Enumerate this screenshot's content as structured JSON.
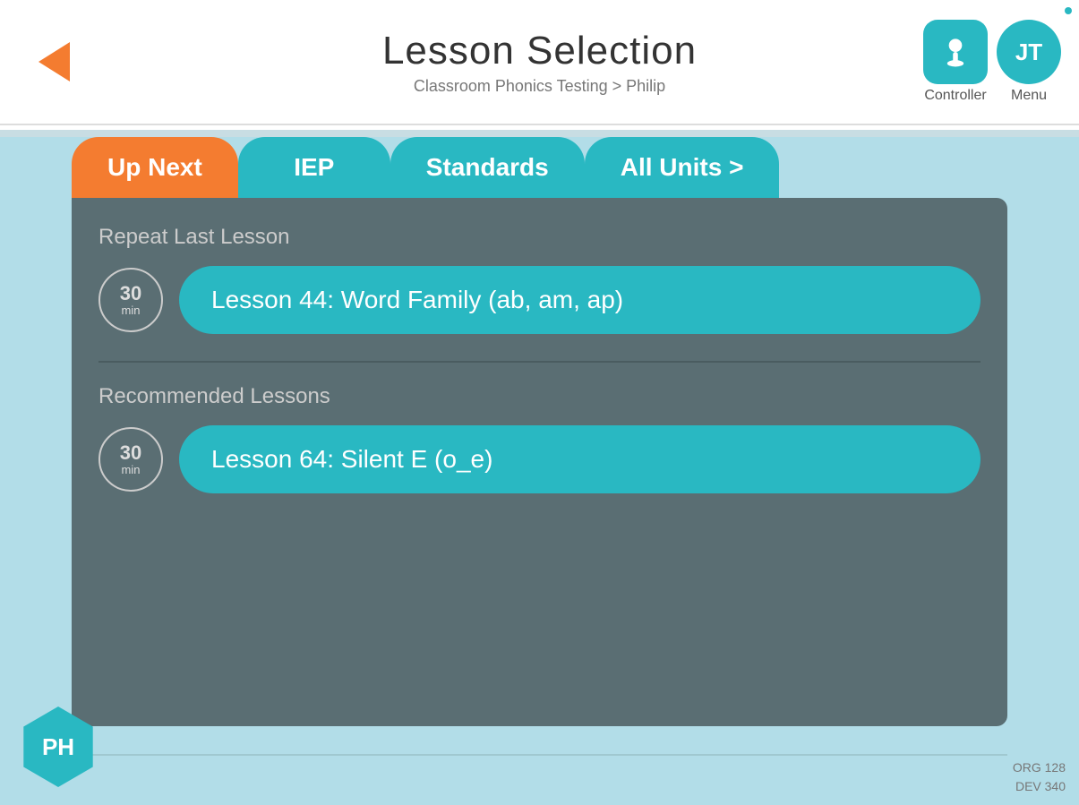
{
  "header": {
    "title": "Lesson Selection",
    "subtitle": "Classroom Phonics Testing  >  Philip",
    "back_label": "back",
    "controller_label": "Controller",
    "menu_label": "Menu",
    "menu_initials": "JT"
  },
  "tabs": [
    {
      "id": "up-next",
      "label": "Up Next",
      "active": true
    },
    {
      "id": "iep",
      "label": "IEP",
      "active": false
    },
    {
      "id": "standards",
      "label": "Standards",
      "active": false
    },
    {
      "id": "all-units",
      "label": "All Units >",
      "active": false
    }
  ],
  "content": {
    "repeat_section": {
      "label": "Repeat Last Lesson",
      "lessons": [
        {
          "time": "30",
          "unit": "min",
          "title": "Lesson 44: Word Family (ab, am, ap)"
        }
      ]
    },
    "recommended_section": {
      "label": "Recommended Lessons",
      "lessons": [
        {
          "time": "30",
          "unit": "min",
          "title": "Lesson 64: Silent E (o_e)"
        }
      ]
    }
  },
  "student": {
    "initials": "PH"
  },
  "version": {
    "line1": "ORG 128",
    "line2": "DEV 340"
  }
}
